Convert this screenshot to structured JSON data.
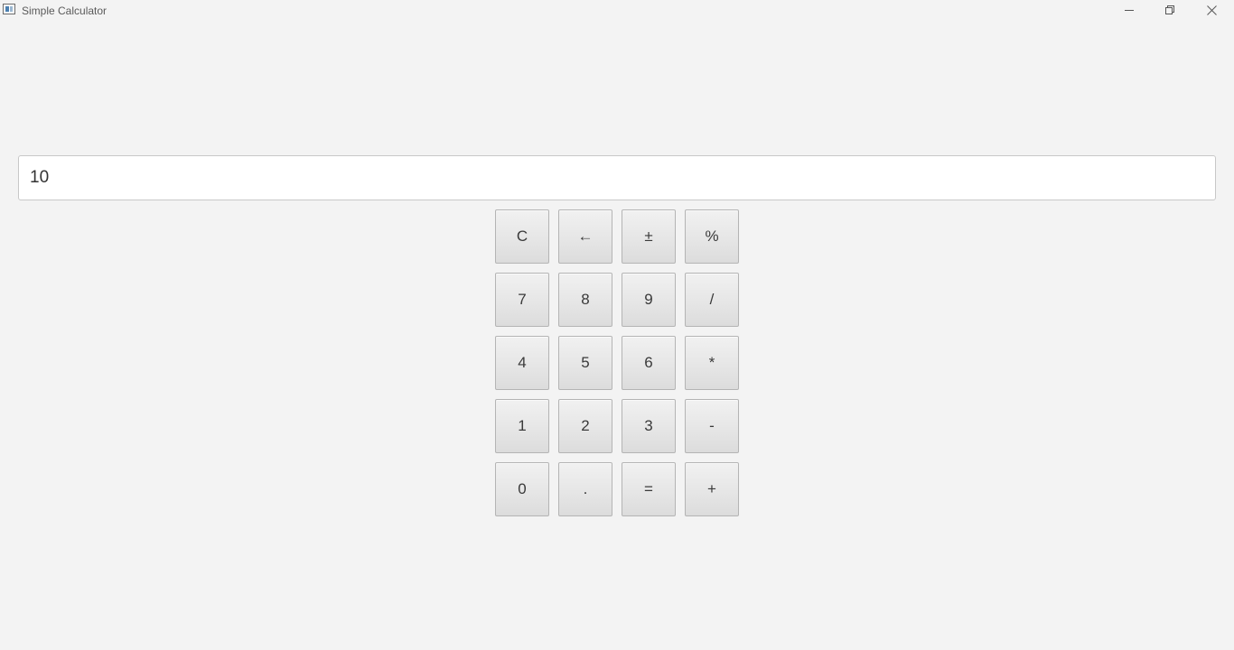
{
  "window": {
    "title": "Simple Calculator",
    "icon": "app-window-icon",
    "controls": {
      "minimize_icon": "minimize-icon",
      "maximize_icon": "restore-icon",
      "close_icon": "close-icon"
    }
  },
  "display": {
    "value": "10"
  },
  "keypad": {
    "rows": [
      [
        {
          "label": "C",
          "name": "clear-button"
        },
        {
          "label": "←",
          "name": "backspace-button"
        },
        {
          "label": "±",
          "name": "negate-button"
        },
        {
          "label": "%",
          "name": "percent-button"
        }
      ],
      [
        {
          "label": "7",
          "name": "digit-7-button"
        },
        {
          "label": "8",
          "name": "digit-8-button"
        },
        {
          "label": "9",
          "name": "digit-9-button"
        },
        {
          "label": "/",
          "name": "divide-button"
        }
      ],
      [
        {
          "label": "4",
          "name": "digit-4-button"
        },
        {
          "label": "5",
          "name": "digit-5-button"
        },
        {
          "label": "6",
          "name": "digit-6-button"
        },
        {
          "label": "*",
          "name": "multiply-button"
        }
      ],
      [
        {
          "label": "1",
          "name": "digit-1-button"
        },
        {
          "label": "2",
          "name": "digit-2-button"
        },
        {
          "label": "3",
          "name": "digit-3-button"
        },
        {
          "label": "-",
          "name": "subtract-button"
        }
      ],
      [
        {
          "label": "0",
          "name": "digit-0-button"
        },
        {
          "label": ".",
          "name": "decimal-point-button"
        },
        {
          "label": "=",
          "name": "equals-button"
        },
        {
          "label": "+",
          "name": "add-button"
        }
      ]
    ]
  },
  "colors": {
    "background": "#f3f3f3",
    "display_background": "#ffffff",
    "button_face": "#e6e6e6",
    "button_border": "#b4b4b4"
  }
}
